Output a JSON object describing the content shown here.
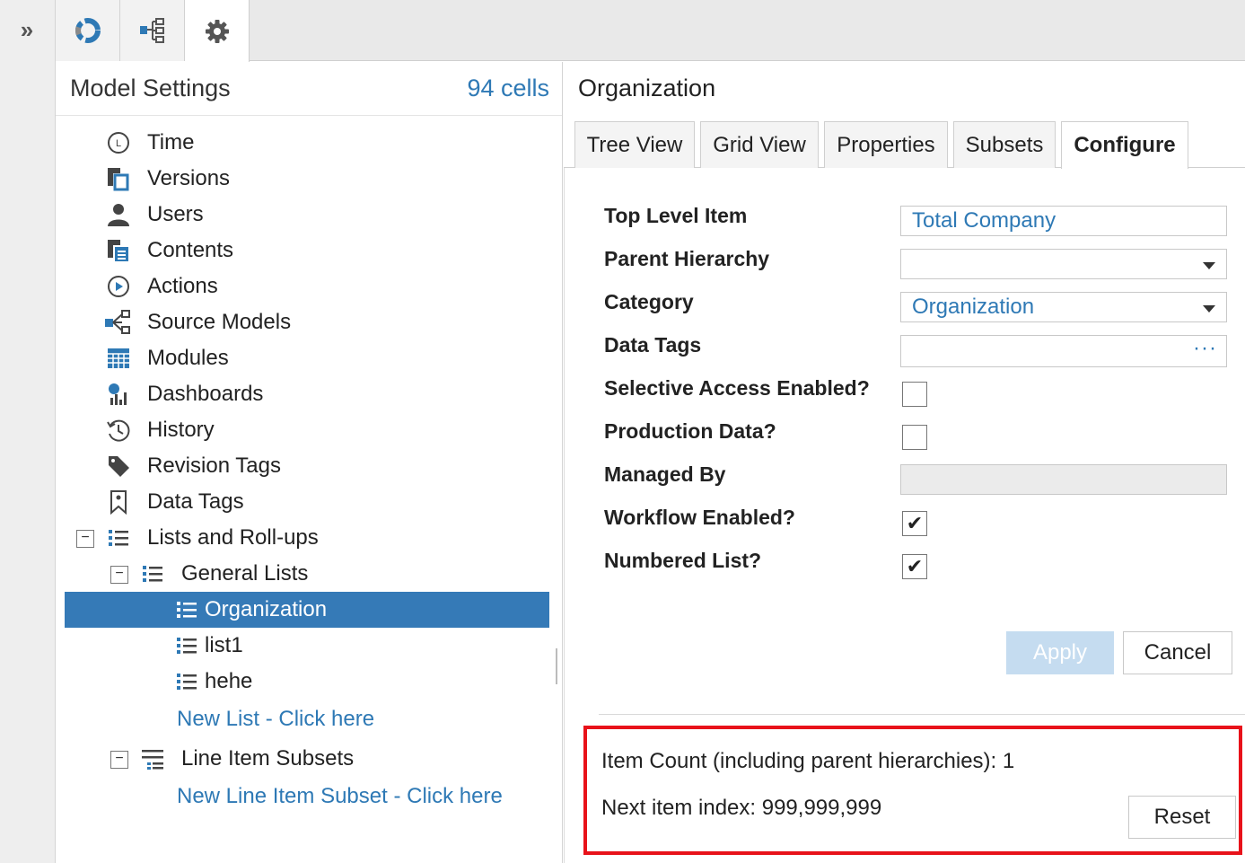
{
  "rail": {
    "expand_label": "»"
  },
  "top_tabs": [
    {
      "name": "dashboard-icon"
    },
    {
      "name": "hierarchy-icon"
    },
    {
      "name": "gear-icon"
    }
  ],
  "left": {
    "title": "Model Settings",
    "count": "94 cells",
    "items": [
      {
        "label": "Time",
        "icon": "clock-icon"
      },
      {
        "label": "Versions",
        "icon": "versions-icon"
      },
      {
        "label": "Users",
        "icon": "user-icon"
      },
      {
        "label": "Contents",
        "icon": "contents-icon"
      },
      {
        "label": "Actions",
        "icon": "play-icon"
      },
      {
        "label": "Source Models",
        "icon": "source-models-icon"
      },
      {
        "label": "Modules",
        "icon": "grid-icon"
      },
      {
        "label": "Dashboards",
        "icon": "dashboard-chart-icon"
      },
      {
        "label": "History",
        "icon": "history-icon"
      },
      {
        "label": "Revision Tags",
        "icon": "tag-icon"
      },
      {
        "label": "Data Tags",
        "icon": "bookmark-icon"
      },
      {
        "label": "Lists and Roll-ups",
        "icon": "list-icon"
      },
      {
        "label": "General Lists",
        "icon": "list-icon"
      },
      {
        "label": "Organization",
        "icon": "list-icon"
      },
      {
        "label": "list1",
        "icon": "list-icon"
      },
      {
        "label": "hehe",
        "icon": "list-icon"
      },
      {
        "label": "Line Item Subsets",
        "icon": "subset-icon"
      }
    ],
    "toggle_symbol": "−",
    "new_list_link": "New List - Click here",
    "new_subset_link": "New Line Item Subset - Click here"
  },
  "right": {
    "title": "Organization",
    "tabs": [
      "Tree View",
      "Grid View",
      "Properties",
      "Subsets",
      "Configure"
    ],
    "active_tab": "Configure",
    "form": {
      "top_level_label": "Top Level Item",
      "top_level_value": "Total Company",
      "parent_hierarchy_label": "Parent Hierarchy",
      "parent_hierarchy_value": "",
      "category_label": "Category",
      "category_value": "Organization",
      "data_tags_label": "Data Tags",
      "data_tags_dots": "···",
      "selective_access_label": "Selective Access Enabled?",
      "production_data_label": "Production Data?",
      "managed_by_label": "Managed By",
      "workflow_label": "Workflow Enabled?",
      "numbered_list_label": "Numbered List?",
      "check_mark": "✔"
    },
    "apply_label": "Apply",
    "cancel_label": "Cancel",
    "item_count_text": "Item Count (including parent hierarchies): 1",
    "next_index_text": "Next item index: 999,999,999",
    "reset_label": "Reset"
  },
  "colors": {
    "accent": "#2e79b5",
    "selected_row": "#357ab7",
    "highlight": "#e8121a",
    "apply_disabled": "#c5dcf0"
  }
}
